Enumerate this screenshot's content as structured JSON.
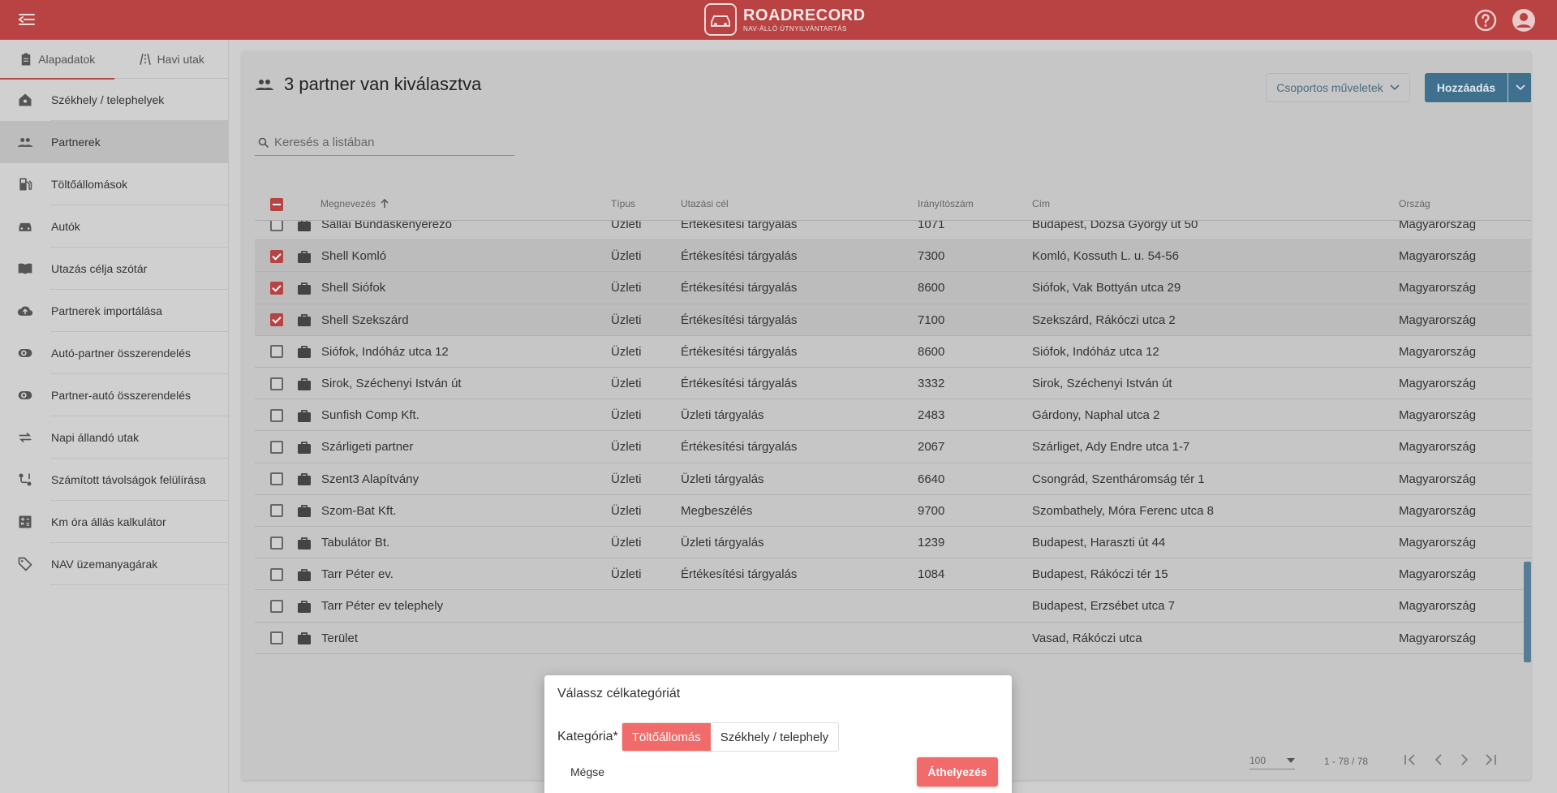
{
  "header": {
    "brand_name": "ROADRECORD",
    "brand_tagline": "NAV-ÁLLÓ ÚTNYILVÁNTARTÁS"
  },
  "sidebar": {
    "tabs": [
      {
        "label": "Alapadatok",
        "active": true
      },
      {
        "label": "Havi utak",
        "active": false
      }
    ],
    "items": [
      {
        "label": "Székhely / telephelyek",
        "icon": "home-icon"
      },
      {
        "label": "Partnerek",
        "icon": "people-icon",
        "active": true
      },
      {
        "label": "Töltőállomások",
        "icon": "fuel-icon"
      },
      {
        "label": "Autók",
        "icon": "car-icon"
      },
      {
        "label": "Utazás célja szótár",
        "icon": "book-icon"
      },
      {
        "label": "Partnerek importálása",
        "icon": "cloud-upload-icon"
      },
      {
        "label": "Autó-partner összerendelés",
        "icon": "toggle-icon"
      },
      {
        "label": "Partner-autó összerendelés",
        "icon": "toggle-icon"
      },
      {
        "label": "Napi állandó utak",
        "icon": "repeat-icon"
      },
      {
        "label": "Számított távolságok felülírása",
        "icon": "route-icon"
      },
      {
        "label": "Km óra állás kalkulátor",
        "icon": "calculator-icon"
      },
      {
        "label": "NAV üzemanyagárak",
        "icon": "tag-icon"
      }
    ]
  },
  "main": {
    "title": "3 partner van kiválasztva",
    "bulk_actions_label": "Csoportos műveletek",
    "add_label": "Hozzáadás",
    "search_placeholder": "Keresés a listában",
    "columns": [
      "Megnevezés",
      "Típus",
      "Utazási cél",
      "Irányítószám",
      "Cím",
      "Ország"
    ],
    "rows": [
      {
        "name": "Sallai Bundáskenyérező",
        "type": "Üzleti",
        "purpose": "Értékesítési tárgyalás",
        "zip": "1071",
        "address": "Budapest, Dózsa György út 50",
        "country": "Magyarország",
        "selected": false
      },
      {
        "name": "Shell Komló",
        "type": "Üzleti",
        "purpose": "Értékesítési tárgyalás",
        "zip": "7300",
        "address": "Komló, Kossuth L. u. 54-56",
        "country": "Magyarország",
        "selected": true
      },
      {
        "name": "Shell Siófok",
        "type": "Üzleti",
        "purpose": "Értékesítési tárgyalás",
        "zip": "8600",
        "address": "Siófok, Vak Bottyán utca 29",
        "country": "Magyarország",
        "selected": true
      },
      {
        "name": "Shell Szekszárd",
        "type": "Üzleti",
        "purpose": "Értékesítési tárgyalás",
        "zip": "7100",
        "address": "Szekszárd, Rákóczi utca 2",
        "country": "Magyarország",
        "selected": true
      },
      {
        "name": "Siófok, Indóház utca 12",
        "type": "Üzleti",
        "purpose": "Értékesítési tárgyalás",
        "zip": "8600",
        "address": "Siófok, Indóház utca 12",
        "country": "Magyarország",
        "selected": false
      },
      {
        "name": "Sirok, Széchenyi István út",
        "type": "Üzleti",
        "purpose": "Értékesítési tárgyalás",
        "zip": "3332",
        "address": "Sirok, Széchenyi István út",
        "country": "Magyarország",
        "selected": false
      },
      {
        "name": "Sunfish Comp Kft.",
        "type": "Üzleti",
        "purpose": "Üzleti tárgyalás",
        "zip": "2483",
        "address": "Gárdony, Naphal utca 2",
        "country": "Magyarország",
        "selected": false
      },
      {
        "name": "Szárligeti partner",
        "type": "Üzleti",
        "purpose": "Értékesítési tárgyalás",
        "zip": "2067",
        "address": "Szárliget, Ady Endre utca 1-7",
        "country": "Magyarország",
        "selected": false
      },
      {
        "name": "Szent3 Alapítvány",
        "type": "Üzleti",
        "purpose": "Üzleti tárgyalás",
        "zip": "6640",
        "address": "Csongrád, Szentháromság tér 1",
        "country": "Magyarország",
        "selected": false
      },
      {
        "name": "Szom-Bat Kft.",
        "type": "Üzleti",
        "purpose": "Megbeszélés",
        "zip": "9700",
        "address": "Szombathely, Móra Ferenc utca 8",
        "country": "Magyarország",
        "selected": false
      },
      {
        "name": "Tabulátor Bt.",
        "type": "Üzleti",
        "purpose": "Üzleti tárgyalás",
        "zip": "1239",
        "address": "Budapest, Haraszti út 44",
        "country": "Magyarország",
        "selected": false
      },
      {
        "name": "Tarr Péter ev.",
        "type": "Üzleti",
        "purpose": "Értékesítési tárgyalás",
        "zip": "1084",
        "address": "Budapest, Rákóczi tér 15",
        "country": "Magyarország",
        "selected": false
      },
      {
        "name": "Tarr Péter ev telephely",
        "type": "",
        "purpose": "",
        "zip": "",
        "address": "Budapest, Erzsébet utca 7",
        "country": "Magyarország",
        "selected": false
      },
      {
        "name": "Terület",
        "type": "",
        "purpose": "",
        "zip": "",
        "address": "Vasad, Rákóczi utca",
        "country": "Magyarország",
        "selected": false
      }
    ],
    "page_size": "100",
    "range": "1 - 78 / 78"
  },
  "dialog": {
    "title": "Válassz célkategóriát",
    "category_label": "Kategória*",
    "options": [
      {
        "label": "Töltőállomás",
        "selected": true
      },
      {
        "label": "Székhely / telephely",
        "selected": false
      }
    ],
    "cancel_label": "Mégse",
    "move_label": "Áthelyezés"
  },
  "colors": {
    "brand_red": "#b94242",
    "accent_blue": "#3f708e",
    "dialog_accent": "#f26b6b"
  }
}
